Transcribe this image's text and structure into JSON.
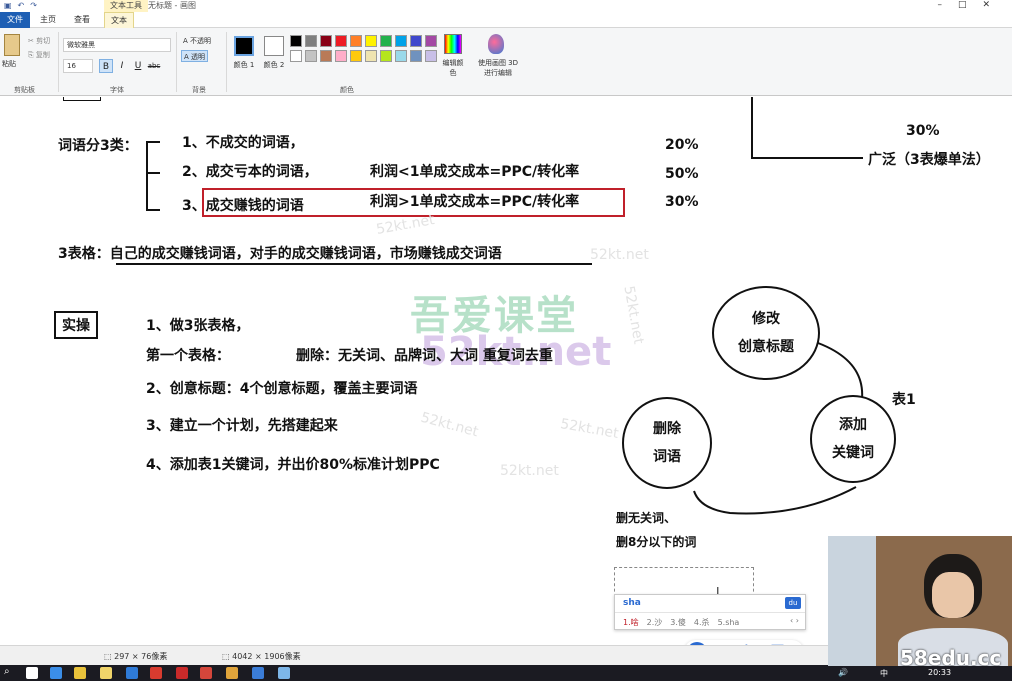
{
  "titlebar": {
    "context_tab": "文本工具",
    "title": "无标题 - 画图"
  },
  "tabs": {
    "file": "文件",
    "home": "主页",
    "view": "查看",
    "text": "文本"
  },
  "ribbon": {
    "clipboard": {
      "paste": "粘贴",
      "cut": "剪切",
      "copy": "复制",
      "label": "剪贴板"
    },
    "font": {
      "family": "微软雅黑",
      "size": "16",
      "bold": "B",
      "italic": "I",
      "underline": "U",
      "strike": "abc",
      "label": "字体"
    },
    "background": {
      "opaque": "不透明",
      "transparent": "透明",
      "label": "背景"
    },
    "colors": {
      "color1": "颜色 1",
      "color2": "颜色 2",
      "edit": "编辑颜色",
      "paint3d": "使用画图 3D 进行编辑",
      "label": "颜色",
      "palette_row1": [
        "#000000",
        "#7f7f7f",
        "#880015",
        "#ed1c24",
        "#ff7f27",
        "#fff200",
        "#22b14c",
        "#00a2e8",
        "#3f48cc",
        "#a349a4"
      ],
      "palette_row2": [
        "#ffffff",
        "#c3c3c3",
        "#b97a57",
        "#ffaec9",
        "#ffc90e",
        "#efe4b0",
        "#b5e61d",
        "#99d9ea",
        "#7092be",
        "#c8bfe7"
      ]
    }
  },
  "canvas": {
    "heading": "词语分3类：",
    "items": [
      {
        "text": "1、不成交的词语，",
        "formula": "",
        "percent": "20%"
      },
      {
        "text": "2、成交亏本的词语，",
        "formula": "利润<1单成交成本=PPC/转化率",
        "percent": "50%"
      },
      {
        "text": "3、成交赚钱的词语",
        "formula": "利润>1单成交成本=PPC/转化率",
        "percent": "30%"
      }
    ],
    "top_right": {
      "percent": "30%",
      "label": "广泛（3表爆单法）"
    },
    "tables_line": "3表格：自己的成交赚钱词语，对手的成交赚钱词语，市场赚钱成交词语",
    "practice_label": "实操",
    "steps": [
      "1、做3张表格，",
      "第一个表格：",
      "2、创意标题：4个创意标题，覆盖主要词语",
      "3、建立一个计划，先搭建起来",
      "4、添加表1关键词，并出价80%标准计划PPC"
    ],
    "delete_note": "删除：无关词、品牌词、大词   重复词去重",
    "watermark_cn": "吾爱课堂",
    "watermark_en": "52kt.net",
    "cycle": {
      "top": [
        "修改",
        "创意标题"
      ],
      "right": [
        "添加",
        "关键词"
      ],
      "left": [
        "删除",
        "词语"
      ],
      "table_label": "表1",
      "notes": [
        "删无关词、",
        "删8分以下的词"
      ]
    }
  },
  "ime": {
    "input": "sha",
    "candidates": [
      "1.啥",
      "2.沙",
      "3.傻",
      "4.杀",
      "5.sha"
    ],
    "lang": "中"
  },
  "statusbar": {
    "selection": "297 × 76像素",
    "canvas_size": "4042 × 1906像素"
  },
  "taskbar": {
    "time": "20:33",
    "lang": "中"
  },
  "webcam_watermark": "58edu.cc"
}
